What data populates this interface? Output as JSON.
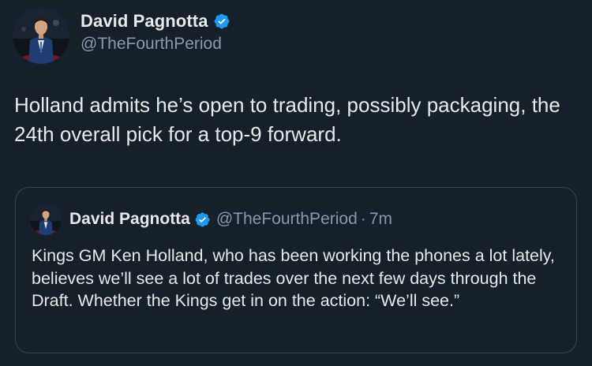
{
  "colors": {
    "background": "#15202b",
    "primary_text": "#e7e9ea",
    "secondary_text": "#8b98a5",
    "verified_blue": "#1d9bf0",
    "card_border": "#38444d"
  },
  "tweet": {
    "author": {
      "display_name": "David Pagnotta",
      "handle": "@TheFourthPeriod",
      "verified_icon": "verified-badge-icon"
    },
    "text": "Holland admits he’s open to trading, possibly packaging, the 24th overall pick for a top-9 forward."
  },
  "quoted_tweet": {
    "author": {
      "display_name": "David Pagnotta",
      "handle": "@TheFourthPeriod",
      "verified_icon": "verified-badge-icon"
    },
    "separator": "·",
    "time": "7m",
    "text": "Kings GM Ken Holland, who has been working the phones a lot lately, believes we’ll see a lot of trades over the next few days through the Draft. Whether the Kings get in on the action: “We’ll see.”"
  }
}
